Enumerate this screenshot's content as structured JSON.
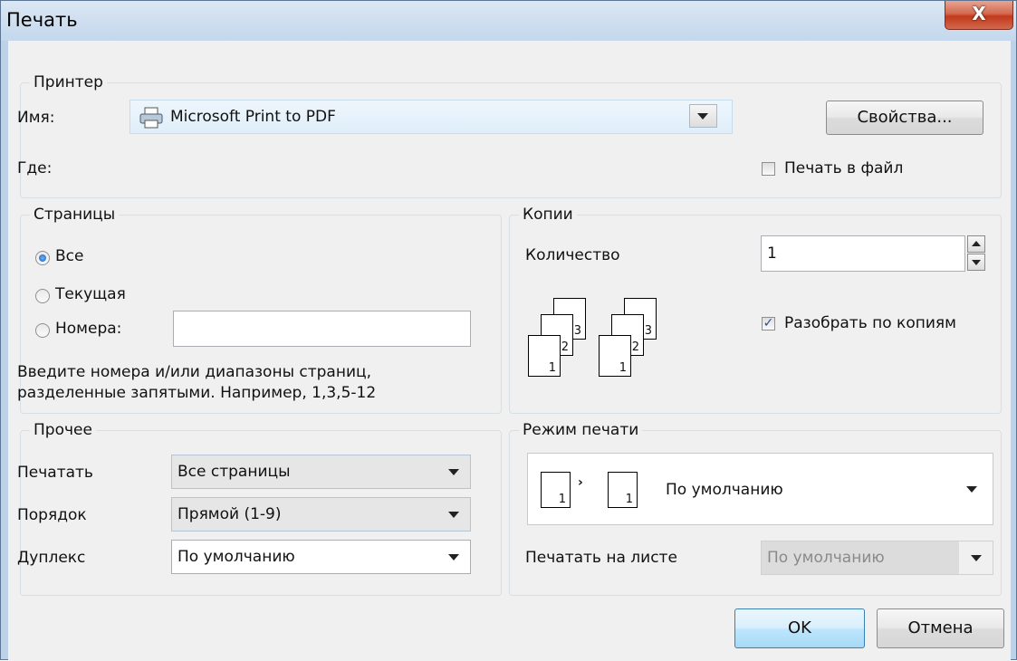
{
  "window": {
    "title": "Печать",
    "close_glyph": "X"
  },
  "printer": {
    "legend": "Принтер",
    "name_label": "Имя:",
    "name_value": "Microsoft Print to PDF",
    "printer_icon": "printer-icon",
    "where_label": "Где:",
    "properties_button": "Свойства...",
    "print_to_file_label": "Печать в файл",
    "print_to_file_checked": false
  },
  "pages": {
    "legend": "Страницы",
    "options": [
      "Все",
      "Текущая",
      "Номера:"
    ],
    "selected": "Все",
    "numbers_value": "",
    "hint_line1": "Введите номера и/или диапазоны страниц,",
    "hint_line2": "разделенные запятыми. Например, 1,3,5-12"
  },
  "copies": {
    "legend": "Копии",
    "count_label": "Количество",
    "count_value": "1",
    "collate_label": "Разобрать по копиям",
    "collate_checked": true,
    "sheet_numbers": [
      "1",
      "2",
      "3"
    ]
  },
  "other": {
    "legend": "Прочее",
    "print_label": "Печатать",
    "print_value": "Все страницы",
    "order_label": "Порядок",
    "order_value": "Прямой (1-9)",
    "duplex_label": "Дуплекс",
    "duplex_value": "По умолчанию"
  },
  "mode": {
    "legend": "Режим печати",
    "mode_value": "По умолчанию",
    "page_digit": "1",
    "sheet_label": "Печатать на листе",
    "sheet_value": "По умолчанию"
  },
  "buttons": {
    "ok": "OK",
    "cancel": "Отмена"
  }
}
